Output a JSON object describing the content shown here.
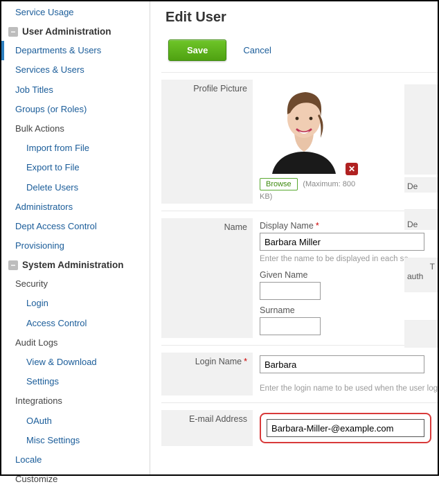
{
  "sidebar": {
    "topItem": "Service Usage",
    "userAdminHead": "User Administration",
    "items": {
      "deptUsers": "Departments & Users",
      "servicesUsers": "Services & Users",
      "jobTitles": "Job Titles",
      "groupsRoles": "Groups (or Roles)",
      "bulkActions": "Bulk Actions",
      "importFile": "Import from File",
      "exportFile": "Export to File",
      "deleteUsers": "Delete Users",
      "administrators": "Administrators",
      "deptAccess": "Dept Access Control",
      "provisioning": "Provisioning"
    },
    "sysAdminHead": "System Administration",
    "sys": {
      "security": "Security",
      "login": "Login",
      "accessControl": "Access Control",
      "auditLogs": "Audit Logs",
      "viewDownload": "View & Download",
      "settings": "Settings",
      "integrations": "Integrations",
      "oauth": "OAuth",
      "miscSettings": "Misc Settings",
      "locale": "Locale",
      "customize": "Customize"
    }
  },
  "page": {
    "title": "Edit User",
    "save": "Save",
    "cancel": "Cancel"
  },
  "form": {
    "profilePictureLabel": "Profile Picture",
    "browse": "Browse",
    "maxNote": "(Maximum: 800 KB)",
    "nameLabel": "Name",
    "displayNameLabel": "Display Name",
    "displayNameValue": "Barbara Miller",
    "displayNameHelper": "Enter the name to be displayed in each se",
    "givenNameLabel": "Given Name",
    "givenNameValue": "",
    "surnameLabel": "Surname",
    "surnameValue": "",
    "loginNameLabel": "Login Name",
    "loginNameValue": "Barbara",
    "loginNameHelper": "Enter the login name to be used when the user log",
    "emailLabel": "E-mail Address",
    "emailValue": "Barbara-Miller-@example.com"
  },
  "stubs": {
    "de1": "De",
    "de2": "De",
    "t": "T",
    "auth": "auth"
  }
}
